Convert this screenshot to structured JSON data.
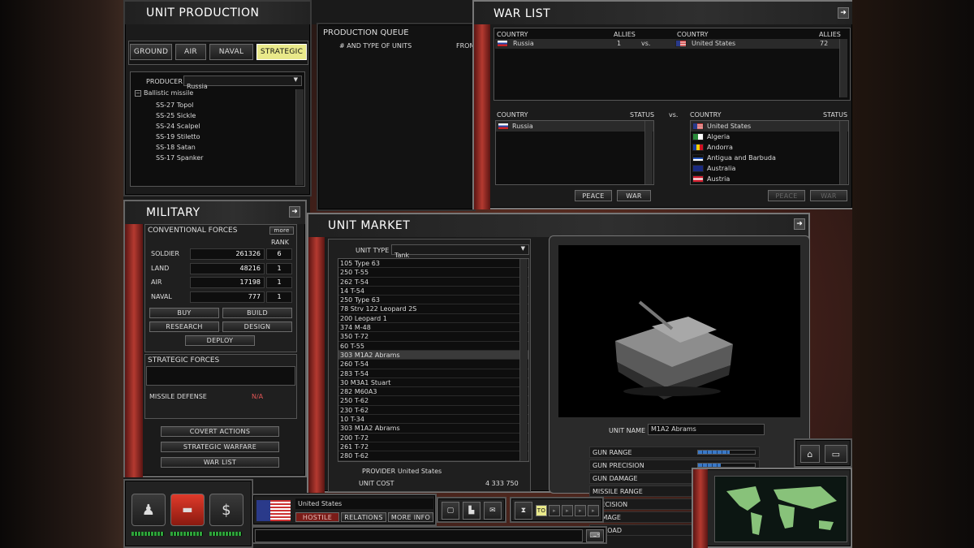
{
  "unit_production": {
    "title": "UNIT PRODUCTION",
    "tabs": [
      "GROUND",
      "AIR",
      "NAVAL",
      "STRATEGIC"
    ],
    "producer_label": "PRODUCER",
    "producer_value": "Russia",
    "tree_root": "Ballistic missile",
    "items": [
      "SS-27 Topol",
      "SS-25 Sickle",
      "SS-24 Scalpel",
      "SS-19 Stiletto",
      "SS-18 Satan",
      "SS-17 Spanker"
    ]
  },
  "production_queue": {
    "title": "PRODUCTION QUEUE",
    "col1": "# AND TYPE OF UNITS",
    "col2": "FROM"
  },
  "war_list": {
    "title": "WAR LIST",
    "country_hdr": "COUNTRY",
    "allies_hdr": "ALLIES",
    "status_hdr": "STATUS",
    "vs": "vs.",
    "war_left": "Russia",
    "war_left_allies": "1",
    "war_right": "United States",
    "war_right_allies": "72",
    "left_list": [
      "Russia"
    ],
    "right_list": [
      "United States",
      "Algeria",
      "Andorra",
      "Antigua and Barbuda",
      "Australia",
      "Austria"
    ],
    "peace": "PEACE",
    "war": "WAR"
  },
  "military": {
    "title": "MILITARY",
    "conv_title": "CONVENTIONAL FORCES",
    "more": "more",
    "rank_hdr": "RANK",
    "rows": [
      {
        "label": "SOLDIER",
        "value": "261326",
        "rank": "6"
      },
      {
        "label": "LAND",
        "value": "48216",
        "rank": "1"
      },
      {
        "label": "AIR",
        "value": "17198",
        "rank": "1"
      },
      {
        "label": "NAVAL",
        "value": "777",
        "rank": "1"
      }
    ],
    "buy": "BUY",
    "build": "BUILD",
    "research": "RESEARCH",
    "design": "DESIGN",
    "deploy": "DEPLOY",
    "strat_title": "STRATEGIC FORCES",
    "missile_defense": "MISSILE DEFENSE",
    "missile_defense_value": "N/A",
    "covert": "COVERT ACTIONS",
    "strategic_warfare": "STRATEGIC WARFARE",
    "war_list_btn": "WAR LIST"
  },
  "unit_market": {
    "title": "UNIT MARKET",
    "unit_type_label": "UNIT TYPE",
    "unit_type_value": "Tank",
    "units": [
      "105 Type 63",
      "250 T-55",
      "262 T-54",
      "14 T-54",
      "250 Type 63",
      "78 Strv 122 Leopard 2S",
      "200 Leopard 1",
      "374 M-48",
      "350 T-72",
      "60 T-55",
      "303 M1A2 Abrams",
      "260 T-54",
      "283 T-54",
      "30 M3A1 Stuart",
      "282 M60A3",
      "250 T-62",
      "230 T-62",
      "10 T-34",
      "303 M1A2 Abrams",
      "200 T-72",
      "261 T-72",
      "280 T-62"
    ],
    "selected_index": 10,
    "provider_label": "PROVIDER",
    "provider_value": "United States",
    "cost_label": "UNIT COST",
    "cost_value": "4 333 750",
    "unit_name_label": "UNIT NAME",
    "unit_name_value": "M1A2 Abrams",
    "stats": [
      {
        "label": "GUN RANGE",
        "level": 0.55
      },
      {
        "label": "GUN PRECISION",
        "level": 0.4
      },
      {
        "label": "GUN DAMAGE",
        "level": 0.45
      },
      {
        "label": "MISSILE RANGE",
        "level": 0
      },
      {
        "label": "PRECISION",
        "level": 0
      },
      {
        "label": "DAMAGE",
        "level": 0
      },
      {
        "label": "PAYLOAD",
        "level": 0
      }
    ]
  },
  "bottom_bar": {
    "country": "United States",
    "hostile": "HOSTILE",
    "relations": "RELATIONS",
    "more_info": "MORE INFO",
    "speed_label": "TO"
  },
  "colors": {
    "accent_red": "#b43a30",
    "selected_tab": "#e9e98a"
  }
}
